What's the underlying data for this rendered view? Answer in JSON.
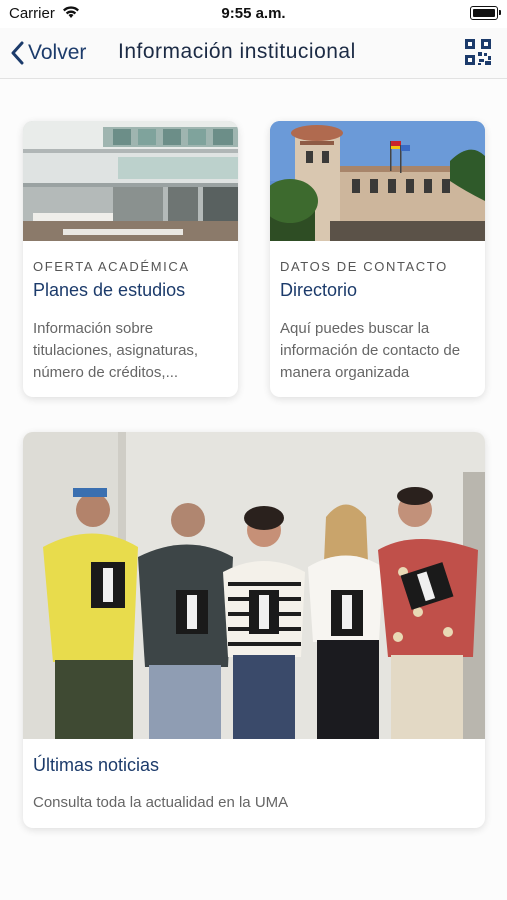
{
  "status_bar": {
    "carrier": "Carrier",
    "time": "9:55 a.m."
  },
  "nav": {
    "back_label": "Volver",
    "title": "Información institucional",
    "qr_icon": "qr-code-icon"
  },
  "cards": [
    {
      "eyebrow": "OFERTA ACADÉMICA",
      "title": "Planes de estudios",
      "description": "Información sobre titulaciones, asignaturas, número de créditos,..."
    },
    {
      "eyebrow": "DATOS DE CONTACTO",
      "title": "Directorio",
      "description": "Aquí puedes buscar la información de contacto de manera organizada"
    },
    {
      "title": "Últimas noticias",
      "description": "Consulta toda la actualidad en la UMA"
    }
  ],
  "colors": {
    "accent": "#1c3b6b",
    "text_muted": "#666666"
  }
}
